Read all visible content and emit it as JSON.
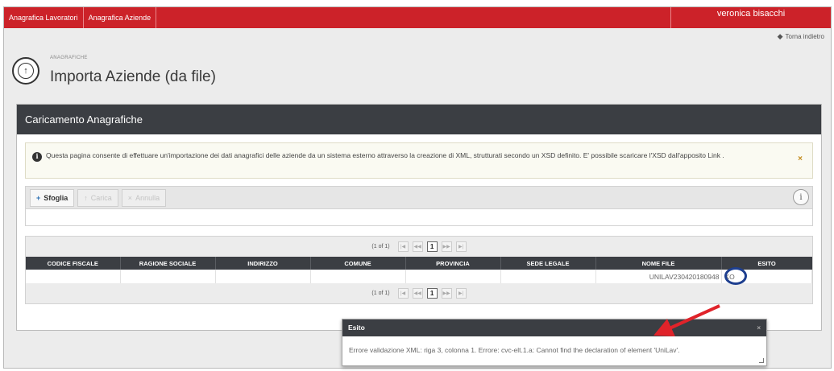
{
  "nav": {
    "items": [
      "Anagrafica Lavoratori",
      "Anagrafica Aziende"
    ],
    "user": "veronica bisacchi",
    "back": "Torna indietro"
  },
  "header": {
    "breadcrumb": "ANAGRAFICHE",
    "title": "Importa Aziende (da file)"
  },
  "panel": {
    "title": "Caricamento Anagrafiche",
    "info_text": "Questa pagina consente di effettuare un'importazione dei dati anagrafici delle aziende da un sistema esterno attraverso la creazione di XML, strutturati secondo un XSD definito. E' possibile scaricare l'XSD dall'apposito Link ."
  },
  "uploader": {
    "browse": "Sfoglia",
    "upload": "Carica",
    "cancel": "Annulla"
  },
  "grid": {
    "paginator": {
      "count": "(1 of 1)",
      "page": "1"
    },
    "columns": [
      "CODICE FISCALE",
      "RAGIONE SOCIALE",
      "INDIRIZZO",
      "COMUNE",
      "PROVINCIA",
      "SEDE LEGALE",
      "NOME FILE",
      "ESITO"
    ],
    "rows": [
      {
        "codice_fiscale": "",
        "ragione_sociale": "",
        "indirizzo": "",
        "comune": "",
        "provincia": "",
        "sede_legale": "",
        "nome_file": "UNILAV230420180948",
        "esito": "KO"
      }
    ]
  },
  "tooltip": {
    "title": "Esito",
    "message": "Errore validazione XML: riga 3, colonna 1. Errore: cvc-elt.1.a: Cannot find the declaration of element 'UniLav'."
  },
  "colors": {
    "nav_red": "#cc2229",
    "header_dark": "#3b3e43",
    "annotation_arrow": "#e0232a",
    "annotation_circle": "#1e3f8f"
  }
}
